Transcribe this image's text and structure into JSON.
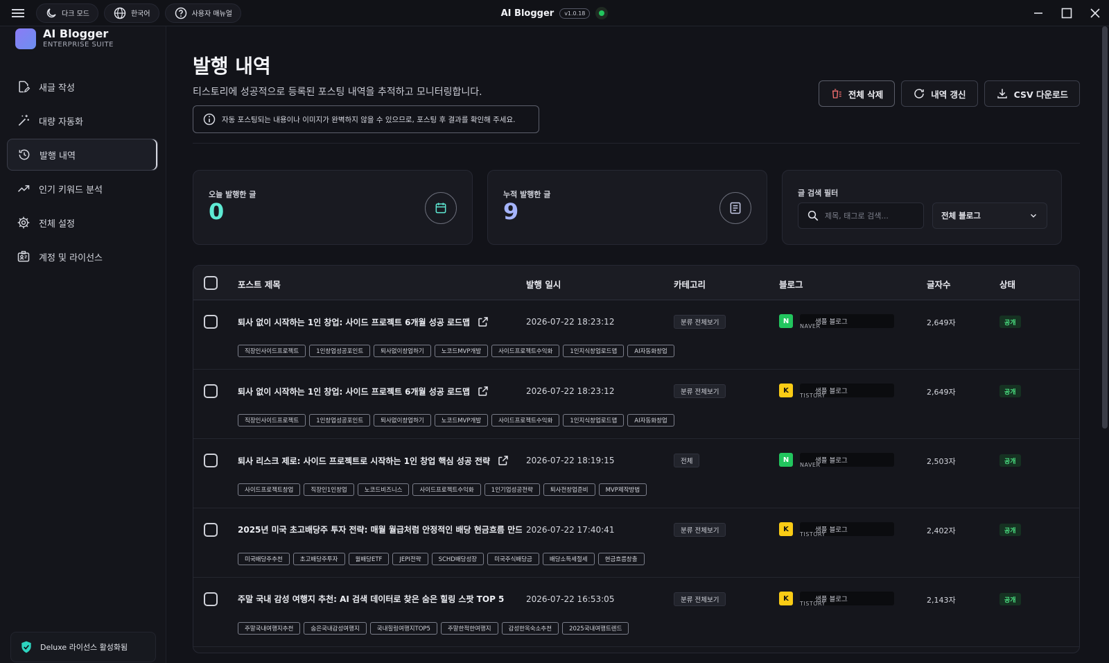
{
  "titlebar": {
    "dark_mode": "다크 모드",
    "language": "한국어",
    "manual": "사용자 매뉴얼",
    "app_name": "AI Blogger",
    "version": "v1.0.18"
  },
  "sidebar": {
    "brand_name": "AI Blogger",
    "brand_sub": "ENTERPRISE SUITE",
    "items": [
      {
        "label": "새글 작성",
        "icon": "new-post-icon"
      },
      {
        "label": "대량 자동화",
        "icon": "magic-wand-icon"
      },
      {
        "label": "발행 내역",
        "icon": "history-icon"
      },
      {
        "label": "인기 키워드 분석",
        "icon": "trend-icon"
      },
      {
        "label": "전체 설정",
        "icon": "gear-icon"
      },
      {
        "label": "계정 및 라이선스",
        "icon": "id-card-icon"
      }
    ],
    "license": "Deluxe 라이선스 활성화됨"
  },
  "page": {
    "title": "발행 내역",
    "subtitle": "티스토리에 성공적으로 등록된 포스팅 내역을 추적하고 모니터링합니다.",
    "notice": "자동 포스팅되는 내용이나 이미지가 완벽하지 않을 수 있으므로, 포스팅 후 결과를 확인해 주세요."
  },
  "actions": {
    "delete_all": "전체 삭제",
    "refresh": "내역 갱신",
    "csv": "CSV 다운로드"
  },
  "stats": {
    "today_label": "오늘 발행한 글",
    "today_value": "0",
    "total_label": "누적 발행한 글",
    "total_value": "9"
  },
  "filter": {
    "label": "글 검색 필터",
    "search_placeholder": "제목, 태그로 검색...",
    "blog_select": "전체 블로그"
  },
  "table": {
    "headers": {
      "title": "포스트 제목",
      "date": "발행 일시",
      "category": "카테고리",
      "blog": "블로그",
      "chars": "글자수",
      "status": "상태"
    },
    "rows": [
      {
        "title": "퇴사 없이 시작하는 1인 창업: 사이드 프로젝트 6개월 성공 로드맵",
        "date": "2026-07-22 18:23:12",
        "category": "분류 전체보기",
        "badge": "N",
        "blog_name": "샘플 블로그",
        "platform": "NAVER",
        "chars": "2,649자",
        "status": "공개",
        "tags": [
          "직장인사이드프로젝트",
          "1인창업성공포인트",
          "퇴사없이창업하기",
          "노코드MVP개발",
          "사이드프로젝트수익화",
          "1인지식창업로드맵",
          "AI자동화창업"
        ]
      },
      {
        "title": "퇴사 없이 시작하는 1인 창업: 사이드 프로젝트 6개월 성공 로드맵",
        "date": "2026-07-22 18:23:12",
        "category": "분류 전체보기",
        "badge": "K",
        "blog_name": "샘플 블로그",
        "platform": "TISTORY",
        "chars": "2,649자",
        "status": "공개",
        "tags": [
          "직장인사이드프로젝트",
          "1인창업성공포인트",
          "퇴사없이창업하기",
          "노코드MVP개발",
          "사이드프로젝트수익화",
          "1인지식창업로드맵",
          "AI자동화창업"
        ]
      },
      {
        "title": "퇴사 리스크 제로: 사이드 프로젝트로 시작하는 1인 창업 핵심 성공 전략",
        "date": "2026-07-22 18:19:15",
        "category": "전체",
        "badge": "N",
        "blog_name": "샘플 블로그",
        "platform": "NAVER",
        "chars": "2,503자",
        "status": "공개",
        "tags": [
          "사이드프로젝트창업",
          "직장인1인창업",
          "노코드비즈니스",
          "사이드프로젝트수익화",
          "1인기업성공전략",
          "퇴사전창업준비",
          "MVP제작방법"
        ]
      },
      {
        "title": "2025년 미국 초고배당주 투자 전략: 매월 월급처럼 안정적인 배당 현금흐름 만드는",
        "date": "2026-07-22 17:40:41",
        "category": "분류 전체보기",
        "badge": "K",
        "blog_name": "샘플 블로그",
        "platform": "TISTORY",
        "chars": "2,402자",
        "status": "공개",
        "tags": [
          "미국배당주추천",
          "초고배당주투자",
          "월배당ETF",
          "JEPI전략",
          "SCHD배당성장",
          "미국주식배당금",
          "배당소득세절세",
          "현금흐름창출"
        ]
      },
      {
        "title": "주말 국내 감성 여행지 추천: AI 검색 데이터로 찾은 숨은 힐링 스팟 TOP 5",
        "date": "2026-07-22 16:53:05",
        "category": "분류 전체보기",
        "badge": "K",
        "blog_name": "샘플 블로그",
        "platform": "TISTORY",
        "chars": "2,143자",
        "status": "공개",
        "tags": [
          "주말국내여행지추천",
          "숨은국내감성여행지",
          "국내힐링여행지TOP5",
          "주말한적한여행지",
          "감성한옥숙소추천",
          "2025국내여행트렌드"
        ]
      }
    ]
  },
  "colors": {
    "accent_teal": "#5eead4",
    "accent_purple": "#a5b4fc",
    "status_green": "#4ade80",
    "naver_green": "#22c55e",
    "kakao_yellow": "#facc15"
  }
}
